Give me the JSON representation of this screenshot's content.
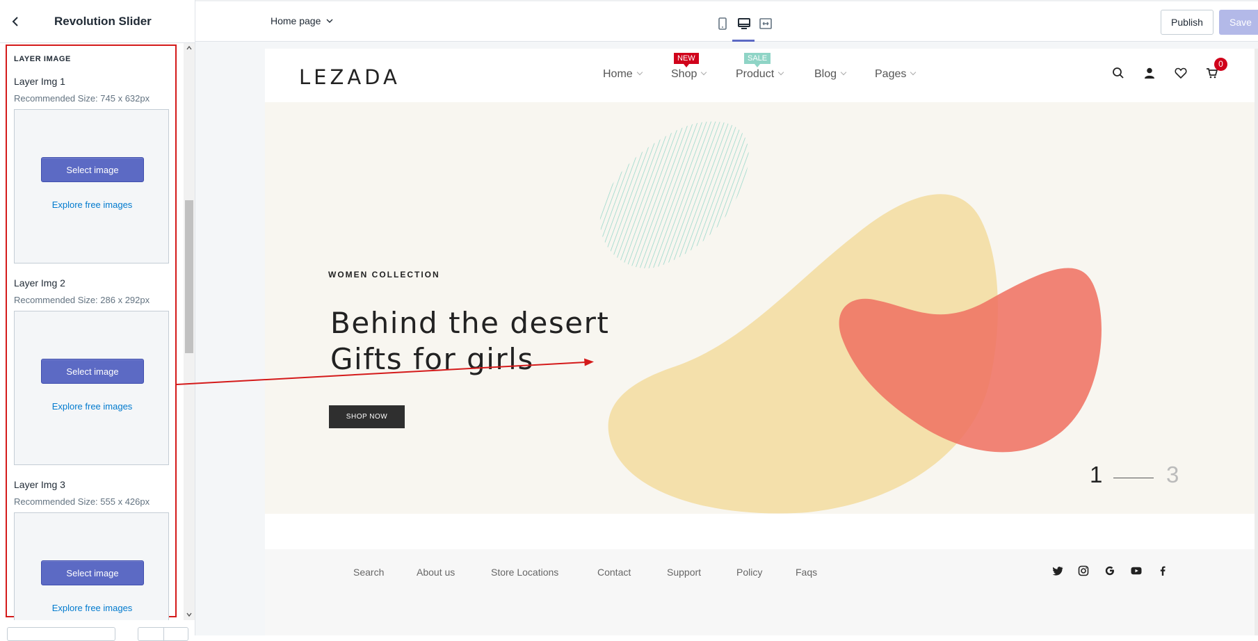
{
  "sidebar": {
    "title": "Revolution Slider",
    "section_title": "LAYER IMAGE",
    "layers": [
      {
        "label": "Layer Img 1",
        "size": "Recommended Size: 745 x 632px",
        "button": "Select image",
        "link": "Explore free images"
      },
      {
        "label": "Layer Img 2",
        "size": "Recommended Size: 286 x 292px",
        "button": "Select image",
        "link": "Explore free images"
      },
      {
        "label": "Layer Img 3",
        "size": "Recommended Size: 555 x 426px",
        "button": "Select image",
        "link": "Explore free images"
      }
    ]
  },
  "topbar": {
    "page_selector": "Home page",
    "devices": [
      "mobile-icon",
      "desktop-icon",
      "fullwidth-icon"
    ],
    "active_device": "desktop",
    "publish": "Publish",
    "save": "Save"
  },
  "store": {
    "logo": "LEZADA",
    "nav": [
      {
        "label": "Home"
      },
      {
        "label": "Shop",
        "badge": "NEW",
        "badge_color": "#d0021b"
      },
      {
        "label": "Product",
        "badge": "SALE",
        "badge_color": "#8fd4c6"
      },
      {
        "label": "Blog"
      },
      {
        "label": "Pages"
      }
    ],
    "cart_count": "0",
    "hero": {
      "eyebrow": "WOMEN COLLECTION",
      "headline_line1": "Behind the desert",
      "headline_line2": "Gifts for girls",
      "cta": "SHOP NOW",
      "pagination_current": "1",
      "pagination_total": "3"
    },
    "footer_links": [
      "Search",
      "About us",
      "Store Locations",
      "Contact",
      "Support",
      "Policy",
      "Faqs"
    ],
    "social": [
      "twitter-icon",
      "instagram-icon",
      "google-icon",
      "youtube-icon",
      "facebook-icon"
    ]
  },
  "colors": {
    "accent": "#5c6ac4",
    "highlight_border": "#d41a1a",
    "hero_bg": "#f8f6f0",
    "blob_yellow": "#f4e0ab",
    "blob_red": "#ef7363",
    "blob_mint": "#8fd4c6"
  }
}
